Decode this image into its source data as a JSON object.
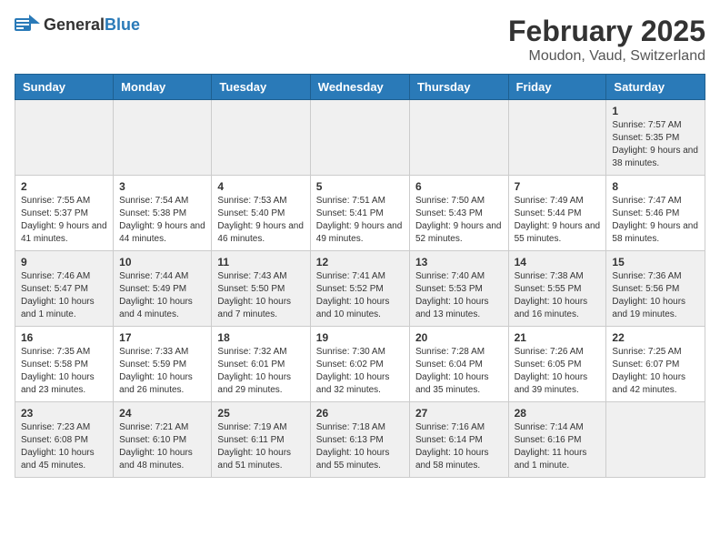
{
  "header": {
    "logo_general": "General",
    "logo_blue": "Blue",
    "month": "February 2025",
    "location": "Moudon, Vaud, Switzerland"
  },
  "weekdays": [
    "Sunday",
    "Monday",
    "Tuesday",
    "Wednesday",
    "Thursday",
    "Friday",
    "Saturday"
  ],
  "weeks": [
    [
      {
        "day": "",
        "info": ""
      },
      {
        "day": "",
        "info": ""
      },
      {
        "day": "",
        "info": ""
      },
      {
        "day": "",
        "info": ""
      },
      {
        "day": "",
        "info": ""
      },
      {
        "day": "",
        "info": ""
      },
      {
        "day": "1",
        "info": "Sunrise: 7:57 AM\nSunset: 5:35 PM\nDaylight: 9 hours and 38 minutes."
      }
    ],
    [
      {
        "day": "2",
        "info": "Sunrise: 7:55 AM\nSunset: 5:37 PM\nDaylight: 9 hours and 41 minutes."
      },
      {
        "day": "3",
        "info": "Sunrise: 7:54 AM\nSunset: 5:38 PM\nDaylight: 9 hours and 44 minutes."
      },
      {
        "day": "4",
        "info": "Sunrise: 7:53 AM\nSunset: 5:40 PM\nDaylight: 9 hours and 46 minutes."
      },
      {
        "day": "5",
        "info": "Sunrise: 7:51 AM\nSunset: 5:41 PM\nDaylight: 9 hours and 49 minutes."
      },
      {
        "day": "6",
        "info": "Sunrise: 7:50 AM\nSunset: 5:43 PM\nDaylight: 9 hours and 52 minutes."
      },
      {
        "day": "7",
        "info": "Sunrise: 7:49 AM\nSunset: 5:44 PM\nDaylight: 9 hours and 55 minutes."
      },
      {
        "day": "8",
        "info": "Sunrise: 7:47 AM\nSunset: 5:46 PM\nDaylight: 9 hours and 58 minutes."
      }
    ],
    [
      {
        "day": "9",
        "info": "Sunrise: 7:46 AM\nSunset: 5:47 PM\nDaylight: 10 hours and 1 minute."
      },
      {
        "day": "10",
        "info": "Sunrise: 7:44 AM\nSunset: 5:49 PM\nDaylight: 10 hours and 4 minutes."
      },
      {
        "day": "11",
        "info": "Sunrise: 7:43 AM\nSunset: 5:50 PM\nDaylight: 10 hours and 7 minutes."
      },
      {
        "day": "12",
        "info": "Sunrise: 7:41 AM\nSunset: 5:52 PM\nDaylight: 10 hours and 10 minutes."
      },
      {
        "day": "13",
        "info": "Sunrise: 7:40 AM\nSunset: 5:53 PM\nDaylight: 10 hours and 13 minutes."
      },
      {
        "day": "14",
        "info": "Sunrise: 7:38 AM\nSunset: 5:55 PM\nDaylight: 10 hours and 16 minutes."
      },
      {
        "day": "15",
        "info": "Sunrise: 7:36 AM\nSunset: 5:56 PM\nDaylight: 10 hours and 19 minutes."
      }
    ],
    [
      {
        "day": "16",
        "info": "Sunrise: 7:35 AM\nSunset: 5:58 PM\nDaylight: 10 hours and 23 minutes."
      },
      {
        "day": "17",
        "info": "Sunrise: 7:33 AM\nSunset: 5:59 PM\nDaylight: 10 hours and 26 minutes."
      },
      {
        "day": "18",
        "info": "Sunrise: 7:32 AM\nSunset: 6:01 PM\nDaylight: 10 hours and 29 minutes."
      },
      {
        "day": "19",
        "info": "Sunrise: 7:30 AM\nSunset: 6:02 PM\nDaylight: 10 hours and 32 minutes."
      },
      {
        "day": "20",
        "info": "Sunrise: 7:28 AM\nSunset: 6:04 PM\nDaylight: 10 hours and 35 minutes."
      },
      {
        "day": "21",
        "info": "Sunrise: 7:26 AM\nSunset: 6:05 PM\nDaylight: 10 hours and 39 minutes."
      },
      {
        "day": "22",
        "info": "Sunrise: 7:25 AM\nSunset: 6:07 PM\nDaylight: 10 hours and 42 minutes."
      }
    ],
    [
      {
        "day": "23",
        "info": "Sunrise: 7:23 AM\nSunset: 6:08 PM\nDaylight: 10 hours and 45 minutes."
      },
      {
        "day": "24",
        "info": "Sunrise: 7:21 AM\nSunset: 6:10 PM\nDaylight: 10 hours and 48 minutes."
      },
      {
        "day": "25",
        "info": "Sunrise: 7:19 AM\nSunset: 6:11 PM\nDaylight: 10 hours and 51 minutes."
      },
      {
        "day": "26",
        "info": "Sunrise: 7:18 AM\nSunset: 6:13 PM\nDaylight: 10 hours and 55 minutes."
      },
      {
        "day": "27",
        "info": "Sunrise: 7:16 AM\nSunset: 6:14 PM\nDaylight: 10 hours and 58 minutes."
      },
      {
        "day": "28",
        "info": "Sunrise: 7:14 AM\nSunset: 6:16 PM\nDaylight: 11 hours and 1 minute."
      },
      {
        "day": "",
        "info": ""
      }
    ]
  ]
}
